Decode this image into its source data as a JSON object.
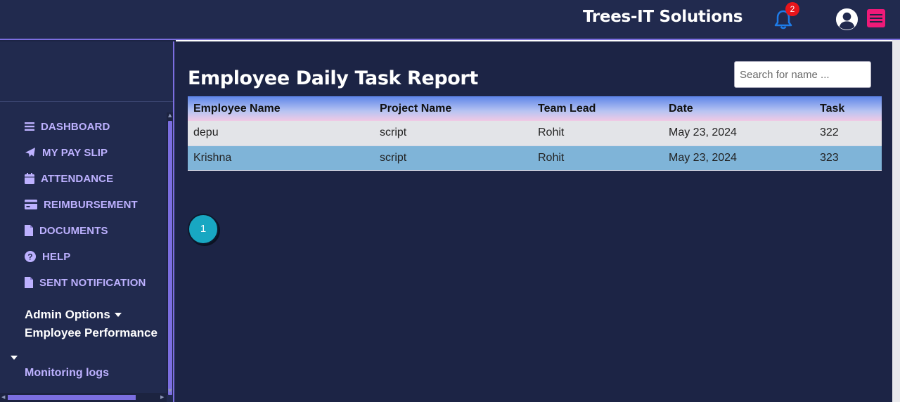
{
  "header": {
    "brand": "Trees-IT Solutions",
    "notification_count": "2",
    "accent_color": "#7b6ee0",
    "menu_color": "#ee1a78"
  },
  "sidebar": {
    "items": [
      {
        "label": "DASHBOARD",
        "icon": "list-icon"
      },
      {
        "label": "MY PAY SLIP",
        "icon": "paper-plane-icon"
      },
      {
        "label": "ATTENDANCE",
        "icon": "calendar-icon"
      },
      {
        "label": "REIMBURSEMENT",
        "icon": "credit-card-icon"
      },
      {
        "label": "DOCUMENTS",
        "icon": "document-icon"
      },
      {
        "label": "HELP",
        "icon": "question-circle-icon"
      },
      {
        "label": "SENT NOTIFICATION",
        "icon": "document-icon"
      }
    ],
    "admin_options": "Admin Options",
    "employee_performance": "Employee Performance",
    "monitoring_logs": "Monitoring logs"
  },
  "main": {
    "title": "Employee Daily Task Report",
    "search": {
      "placeholder": "Search for name ...",
      "value": ""
    },
    "table": {
      "columns": [
        "Employee Name",
        "Project Name",
        "Team Lead",
        "Date",
        "Task"
      ],
      "rows": [
        [
          "depu",
          "script",
          "Rohit",
          "May 23, 2024",
          "322"
        ],
        [
          "Krishna",
          "script",
          "Rohit",
          "May 23, 2024",
          "323"
        ]
      ]
    },
    "pagination": {
      "current_page": "1"
    }
  }
}
